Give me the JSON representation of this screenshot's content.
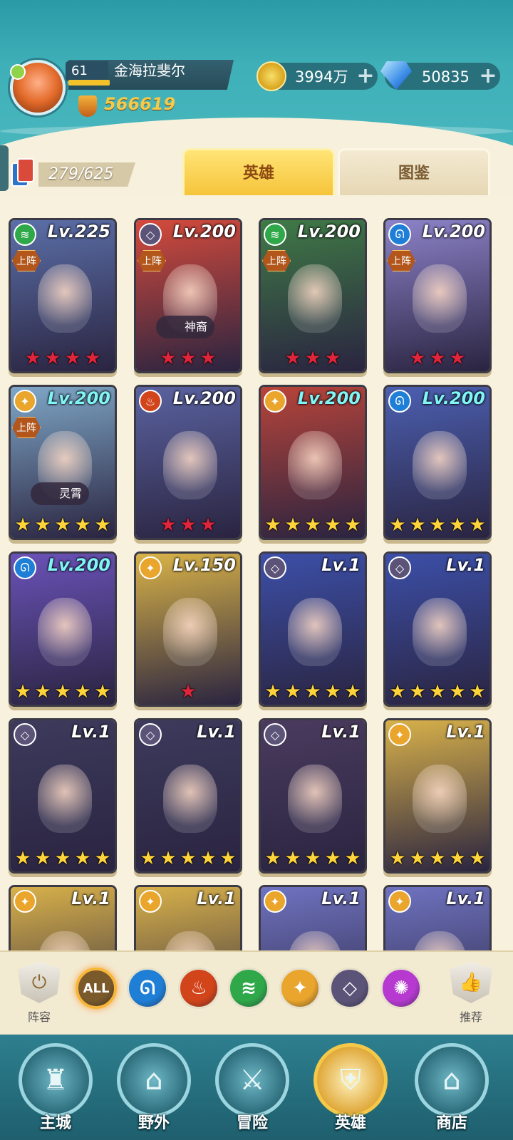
{
  "player": {
    "level": "61",
    "name": "金海拉斐尔",
    "power": "566619",
    "exp_fraction": 0.25
  },
  "resources": {
    "coins": "3994万",
    "gems": "50835"
  },
  "collection": {
    "count": "279/625"
  },
  "tabs": {
    "hero": "英雄",
    "codex": "图鉴"
  },
  "heroes": [
    {
      "level": "Lv.225",
      "faction": "forest",
      "on_team": "上阵",
      "tag": "",
      "stars": 4,
      "star_color": "red",
      "level_color": "white",
      "art": "#5b6fa8"
    },
    {
      "level": "Lv.200",
      "faction": "void",
      "on_team": "上阵",
      "tag": "神裔",
      "stars": 3,
      "star_color": "red",
      "level_color": "white",
      "art": "#d44a3c"
    },
    {
      "level": "Lv.200",
      "faction": "forest",
      "on_team": "上阵",
      "tag": "",
      "stars": 3,
      "star_color": "red",
      "level_color": "white",
      "art": "#3f7a46"
    },
    {
      "level": "Lv.200",
      "faction": "water",
      "on_team": "上阵",
      "tag": "",
      "stars": 3,
      "star_color": "red",
      "level_color": "white",
      "art": "#8c82c9"
    },
    {
      "level": "Lv.200",
      "faction": "light",
      "on_team": "上阵",
      "tag": "灵霄",
      "stars": 5,
      "star_color": "gold",
      "level_color": "cyan",
      "art": "#7fa7c7"
    },
    {
      "level": "Lv.200",
      "faction": "fire",
      "on_team": "",
      "tag": "",
      "stars": 3,
      "star_color": "red",
      "level_color": "white",
      "art": "#5a62a0"
    },
    {
      "level": "Lv.200",
      "faction": "light",
      "on_team": "",
      "tag": "",
      "stars": 5,
      "star_color": "gold",
      "level_color": "cyan",
      "art": "#b8443a"
    },
    {
      "level": "Lv.200",
      "faction": "water",
      "on_team": "",
      "tag": "",
      "stars": 5,
      "star_color": "gold",
      "level_color": "cyan",
      "art": "#4b5fb1"
    },
    {
      "level": "Lv.200",
      "faction": "water",
      "on_team": "",
      "tag": "",
      "stars": 5,
      "star_color": "gold",
      "level_color": "cyan",
      "art": "#6a52b8"
    },
    {
      "level": "Lv.150",
      "faction": "light",
      "on_team": "",
      "tag": "",
      "stars": 1,
      "star_color": "red",
      "level_color": "white",
      "art": "#d9b348"
    },
    {
      "level": "Lv.1",
      "faction": "void",
      "on_team": "",
      "tag": "",
      "stars": 5,
      "star_color": "gold",
      "level_color": "white",
      "art": "#3c4fa8"
    },
    {
      "level": "Lv.1",
      "faction": "void",
      "on_team": "",
      "tag": "",
      "stars": 5,
      "star_color": "gold",
      "level_color": "white",
      "art": "#3c4fa8"
    },
    {
      "level": "Lv.1",
      "faction": "void",
      "on_team": "",
      "tag": "",
      "stars": 5,
      "star_color": "gold",
      "level_color": "white",
      "art": "#3d3a5c"
    },
    {
      "level": "Lv.1",
      "faction": "void",
      "on_team": "",
      "tag": "",
      "stars": 5,
      "star_color": "gold",
      "level_color": "white",
      "art": "#3d3a5c"
    },
    {
      "level": "Lv.1",
      "faction": "void",
      "on_team": "",
      "tag": "",
      "stars": 5,
      "star_color": "gold",
      "level_color": "white",
      "art": "#4a3b5e"
    },
    {
      "level": "Lv.1",
      "faction": "light",
      "on_team": "",
      "tag": "",
      "stars": 5,
      "star_color": "gold",
      "level_color": "white",
      "art": "#d8b14a"
    },
    {
      "level": "Lv.1",
      "faction": "light",
      "on_team": "",
      "tag": "",
      "stars": 0,
      "star_color": "gold",
      "level_color": "white",
      "art": "#d8b14a"
    },
    {
      "level": "Lv.1",
      "faction": "light",
      "on_team": "",
      "tag": "",
      "stars": 0,
      "star_color": "gold",
      "level_color": "white",
      "art": "#d8b14a"
    },
    {
      "level": "Lv.1",
      "faction": "light",
      "on_team": "",
      "tag": "",
      "stars": 0,
      "star_color": "gold",
      "level_color": "white",
      "art": "#6f73c0"
    },
    {
      "level": "Lv.1",
      "faction": "light",
      "on_team": "",
      "tag": "",
      "stars": 0,
      "star_color": "gold",
      "level_color": "white",
      "art": "#6f73c0"
    }
  ],
  "factions": {
    "forest": {
      "color": "#2fa84a",
      "glyph": "≋"
    },
    "void": {
      "color": "#5c5478",
      "glyph": "◇"
    },
    "water": {
      "color": "#1f7fd6",
      "glyph": "ᘏ"
    },
    "fire": {
      "color": "#d2441a",
      "glyph": "♨"
    },
    "light": {
      "color": "#e9a52c",
      "glyph": "✦"
    },
    "dark": {
      "color": "#b63ad0",
      "glyph": "✺"
    }
  },
  "filters": {
    "team_label": "阵容",
    "recommend_label": "推荐",
    "items": [
      {
        "name": "all",
        "label": "ALL",
        "color": "#7a5a2a",
        "active": true
      },
      {
        "name": "water",
        "label": "ᘏ",
        "color": "#1f7fd6",
        "active": false
      },
      {
        "name": "fire",
        "label": "♨",
        "color": "#d2441a",
        "active": false
      },
      {
        "name": "forest",
        "label": "≋",
        "color": "#2fa84a",
        "active": false
      },
      {
        "name": "light",
        "label": "✦",
        "color": "#e9a52c",
        "active": false
      },
      {
        "name": "void",
        "label": "◇",
        "color": "#5c5478",
        "active": false
      },
      {
        "name": "dark",
        "label": "✺",
        "color": "#b63ad0",
        "active": false
      }
    ]
  },
  "nav": [
    {
      "name": "main-city",
      "label": "主城",
      "icon": "castle-icon",
      "glyph": "♜",
      "active": false
    },
    {
      "name": "wild",
      "label": "野外",
      "icon": "portal-icon",
      "glyph": "⌂",
      "active": false
    },
    {
      "name": "adventure",
      "label": "冒险",
      "icon": "sword-icon",
      "glyph": "⚔",
      "active": false
    },
    {
      "name": "hero",
      "label": "英雄",
      "icon": "helmet-icon",
      "glyph": "⛨",
      "active": true
    },
    {
      "name": "shop",
      "label": "商店",
      "icon": "shop-icon",
      "glyph": "⌂",
      "active": false
    }
  ]
}
